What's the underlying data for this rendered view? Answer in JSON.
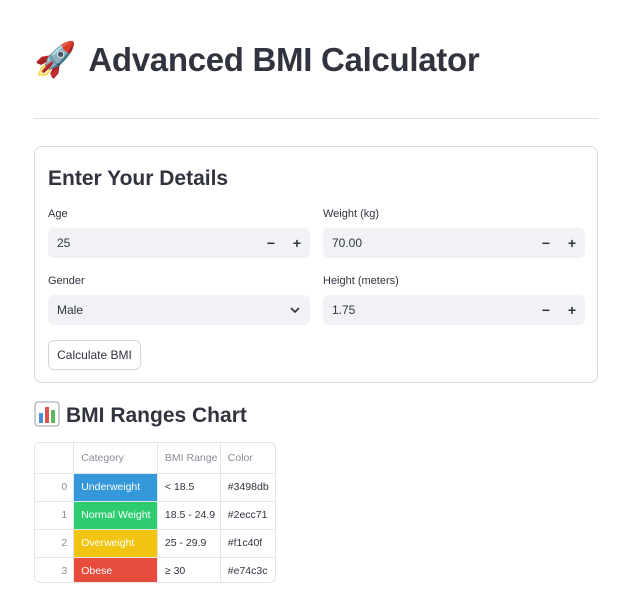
{
  "header": {
    "icon": "rocket-icon",
    "title": "Advanced BMI Calculator"
  },
  "form": {
    "heading": "Enter Your Details",
    "age": {
      "label": "Age",
      "value": "25",
      "minus": "−",
      "plus": "+"
    },
    "weight": {
      "label": "Weight (kg)",
      "value": "70.00",
      "minus": "−",
      "plus": "+"
    },
    "gender": {
      "label": "Gender",
      "value": "Male"
    },
    "height": {
      "label": "Height (meters)",
      "value": "1.75",
      "minus": "−",
      "plus": "+"
    },
    "button_label": "Calculate BMI"
  },
  "ranges": {
    "icon": "bar-chart-icon",
    "heading": "BMI Ranges Chart",
    "columns": [
      "Category",
      "BMI Range",
      "Color"
    ],
    "rows": [
      {
        "index": "0",
        "category": "Underweight",
        "range": "< 18.5",
        "color": "#3498db"
      },
      {
        "index": "1",
        "category": "Normal Weight",
        "range": "18.5 - 24.9",
        "color": "#2ecc71"
      },
      {
        "index": "2",
        "category": "Overweight",
        "range": "25 - 29.9",
        "color": "#f1c40f"
      },
      {
        "index": "3",
        "category": "Obese",
        "range": "≥ 30",
        "color": "#e74c3c"
      }
    ]
  },
  "colors": {
    "text": "#31333f",
    "input_bg": "#f0f2f6",
    "border": "#d9dadf",
    "muted": "#8b8d98"
  }
}
